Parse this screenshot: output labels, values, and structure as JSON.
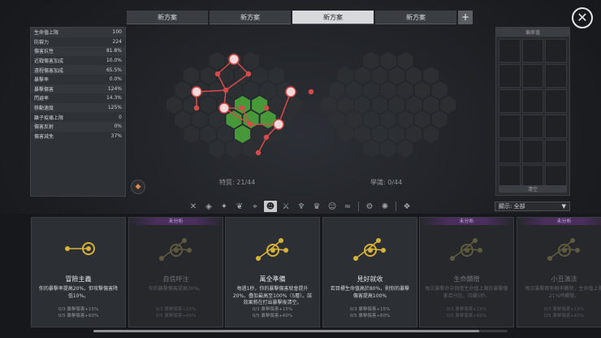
{
  "tabs": [
    {
      "label": "新方案",
      "active": false
    },
    {
      "label": "新方案",
      "active": false
    },
    {
      "label": "新方案",
      "active": true
    },
    {
      "label": "新方案",
      "active": false
    }
  ],
  "add_tab_label": "+",
  "close_label": "✕",
  "stats": [
    {
      "name": "生命值上限",
      "value": "100"
    },
    {
      "name": "防禦力",
      "value": "224"
    },
    {
      "name": "傷害抗性",
      "value": "81.8%"
    },
    {
      "name": "近戰傷害加成",
      "value": "10.0%"
    },
    {
      "name": "遠程傷害加成",
      "value": "65.5%"
    },
    {
      "name": "暴擊率",
      "value": "0.0%"
    },
    {
      "name": "暴擊傷害",
      "value": "124%"
    },
    {
      "name": "閃避率",
      "value": "14.3%"
    },
    {
      "name": "移動速度",
      "value": "125%"
    },
    {
      "name": "離子疫痛上限",
      "value": "0"
    },
    {
      "name": "傷害反射",
      "value": "0%"
    },
    {
      "name": "傷害減免",
      "value": "37%"
    }
  ],
  "graph": {
    "left_label": "特質: 21/44",
    "right_label": "學識: 0/44"
  },
  "slots": {
    "title": "偏差值",
    "button": "清空"
  },
  "filters": {
    "icons": [
      "butterfly-icon",
      "shield-wing-icon",
      "bird-icon",
      "leaf-icon",
      "crosshair-icon",
      "mask-icon",
      "crossed-swords-icon",
      "fish-icon",
      "crown-icon",
      "people-icon",
      "wave-icon",
      "gear-icon",
      "gear-alt-icon",
      "molecule-icon"
    ],
    "active_index": 5,
    "dropdown_label": "顯示: 全部",
    "dropdown_arrow": "▼"
  },
  "cards": [
    {
      "title": "冒險主義",
      "tag": "",
      "locked": false,
      "desc": "你的暴擊率提高20%，但攻擊傷害降低10%。",
      "foot1": "0/3 暴擊傷害+15%",
      "foot2": "0/5 暴擊傷害+60%"
    },
    {
      "title": "自信呼注",
      "tag": "未分析",
      "locked": true,
      "desc": "你的暴擊傷害提高30%。",
      "foot1": "0/3 暴擊傷害+15%",
      "foot2": "0/5 暴擊傷害+60%"
    },
    {
      "title": "萬全準備",
      "tag": "",
      "locked": false,
      "desc": "每過1秒，你的暴擊傷害就會提升20%，疊加最高至100%（5層）。該效果將在打出暴擊後清空。",
      "foot1": "0/3 暴擊傷害+15%",
      "foot2": "0/5 暴擊傷害+60%"
    },
    {
      "title": "見好就收",
      "tag": "",
      "locked": false,
      "desc": "若目標生命值高於80%，則你的暴擊傷害提高100%",
      "foot1": "0/3 暴擊傷害+15%",
      "foot2": "0/5 暴擊傷害+60%"
    },
    {
      "title": "生命饋贈",
      "tag": "未分析",
      "locked": true,
      "desc": "每次暴擊命中回復生命值上限的暴擊傷害百分比，持續5秒。",
      "foot1": "0/3 暴擊傷害+15%",
      "foot2": "0/5 暴擊傷害+60%"
    },
    {
      "title": "小丑演法",
      "tag": "未分析",
      "locked": true,
      "desc": "每次暴擊都有概率觸發，生命值上限21%時觸發。",
      "foot1": "0/3 暴擊傷害+15%",
      "foot2": "0/5 暴擊傷害+60%"
    }
  ],
  "colors": {
    "node_red": "#d84a4a",
    "node_green": "#4aa43a",
    "node_gold": "#d6b23a",
    "hex_dark": "#2e3034"
  }
}
